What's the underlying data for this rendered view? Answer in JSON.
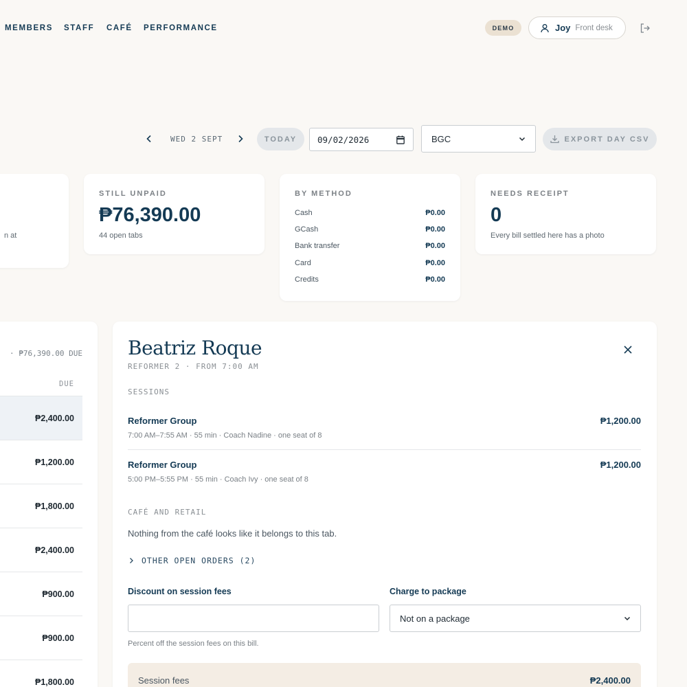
{
  "nav": {
    "links": [
      "MEMBERS",
      "STAFF",
      "CAFÉ",
      "PERFORMANCE"
    ],
    "demo_badge": "DEMO",
    "user": {
      "name": "Joy",
      "role": "Front desk"
    }
  },
  "toolbar": {
    "date_label": "WED 2 SEPT",
    "today_label": "TODAY",
    "date_value": "09/02/2026",
    "location": "BGC",
    "export_label": "EXPORT DAY CSV"
  },
  "cards": {
    "partial_text": "n at",
    "unpaid": {
      "label": "STILL UNPAID",
      "amount": "₱76,390.00",
      "sub": "44 open tabs"
    },
    "by_method": {
      "label": "BY METHOD",
      "rows": [
        {
          "name": "Cash",
          "value": "₱0.00"
        },
        {
          "name": "GCash",
          "value": "₱0.00"
        },
        {
          "name": "Bank transfer",
          "value": "₱0.00"
        },
        {
          "name": "Card",
          "value": "₱0.00"
        },
        {
          "name": "Credits",
          "value": "₱0.00"
        }
      ]
    },
    "receipt": {
      "label": "NEEDS RECEIPT",
      "value": "0",
      "sub": "Every bill settled here has a photo"
    }
  },
  "list": {
    "summary": "· ₱76,390.00 DUE",
    "column_due": "DUE",
    "rows": [
      "₱2,400.00",
      "₱1,200.00",
      "₱1,800.00",
      "₱2,400.00",
      "₱900.00",
      "₱900.00",
      "₱1,800.00"
    ]
  },
  "detail": {
    "name": "Beatriz Roque",
    "subtitle": "REFORMER 2 · FROM 7:00 AM",
    "sessions_heading": "SESSIONS",
    "sessions": [
      {
        "title": "Reformer Group",
        "meta": "7:00 AM–7:55 AM · 55 min · Coach Nadine · one seat of 8",
        "price": "₱1,200.00"
      },
      {
        "title": "Reformer Group",
        "meta": "5:00 PM–5:55 PM · 55 min · Coach Ivy · one seat of 8",
        "price": "₱1,200.00"
      }
    ],
    "cafe_heading": "CAFÉ AND RETAIL",
    "cafe_text": "Nothing from the café looks like it belongs to this tab.",
    "other_orders": "OTHER OPEN ORDERS (2)",
    "discount_label": "Discount on session fees",
    "discount_value": "",
    "discount_hint": "Percent off the session fees on this bill.",
    "package_label": "Charge to package",
    "package_value": "Not on a package",
    "fees_label": "Session fees",
    "fees_value": "₱2,400.00"
  }
}
